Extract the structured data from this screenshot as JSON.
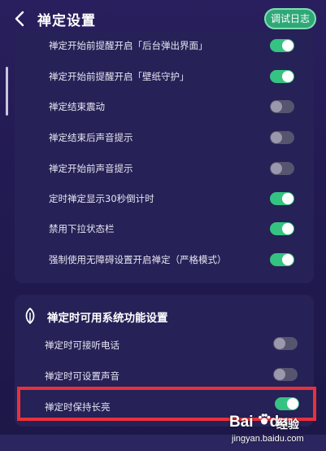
{
  "header": {
    "title": "禅定设置",
    "log_button": "调试日志"
  },
  "settings_card": {
    "items": [
      {
        "label": "禅定开始前提醒开启「后台弹出界面」",
        "enabled": true
      },
      {
        "label": "禅定开始前提醒开启「壁纸守护」",
        "enabled": true
      },
      {
        "label": "禅定结束震动",
        "enabled": false
      },
      {
        "label": "禅定结束后声音提示",
        "enabled": false
      },
      {
        "label": "禅定开始前声音提示",
        "enabled": false
      },
      {
        "label": "定时禅定显示30秒倒计时",
        "enabled": true
      },
      {
        "label": "禁用下拉状态栏",
        "enabled": true
      },
      {
        "label": "强制使用无障碍设置开启禅定（严格模式）",
        "enabled": true
      }
    ]
  },
  "system_card": {
    "title": "禅定时可用系统功能设置",
    "items": [
      {
        "label": "禅定时可接听电话",
        "enabled": false
      },
      {
        "label": "禅定时可设置声音",
        "enabled": false
      },
      {
        "label": "禅定时保持长亮",
        "enabled": true
      }
    ]
  },
  "watermark": {
    "brand_left": "Bai",
    "brand_right": "du",
    "jingyan": "经验",
    "url": "jingyan.baidu.com"
  },
  "colors": {
    "toggle_on": "#35c382",
    "toggle_off": "#56546f",
    "highlight": "#e8313b",
    "card": "#262156"
  }
}
